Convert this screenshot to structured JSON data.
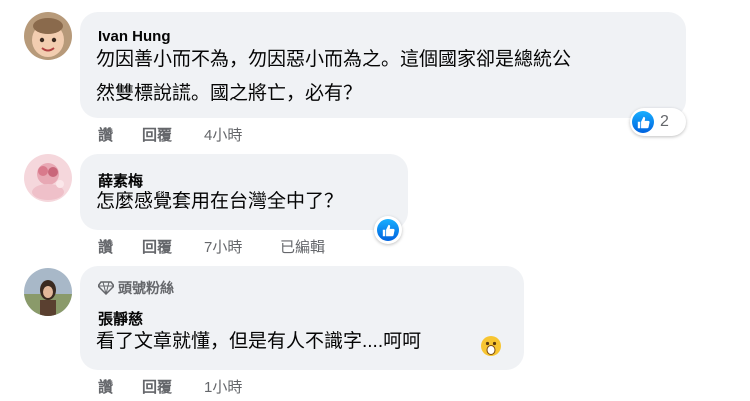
{
  "comments": [
    {
      "author": "Ivan Hung",
      "text_line1": "勿因善小而不為，勿因惡小而為之。這個國家卻是總統公",
      "text_line2": "然雙標說謊。國之將亡，必有？",
      "like_label": "讚",
      "reply_label": "回覆",
      "time": "4小時",
      "reaction_count": "2",
      "reaction_icon": "like-icon"
    },
    {
      "author": "薛素梅",
      "text_line1": "怎麼感覺套用在台灣全中了？",
      "like_label": "讚",
      "reply_label": "回覆",
      "time": "7小時",
      "edited": "已編輯",
      "reaction_icon": "like-icon"
    },
    {
      "badge": "頭號粉絲",
      "badge_icon": "diamond-icon",
      "author": "張靜慈",
      "text_line1": "看了文章就懂，但是有人不識字....呵呵",
      "emoji": "shocked-face-emoji",
      "like_label": "讚",
      "reply_label": "回覆",
      "time": "1小時"
    }
  ],
  "colors": {
    "bubble": "#f0f2f5",
    "meta_text": "#65676b",
    "like_blue": "#1877f2"
  }
}
